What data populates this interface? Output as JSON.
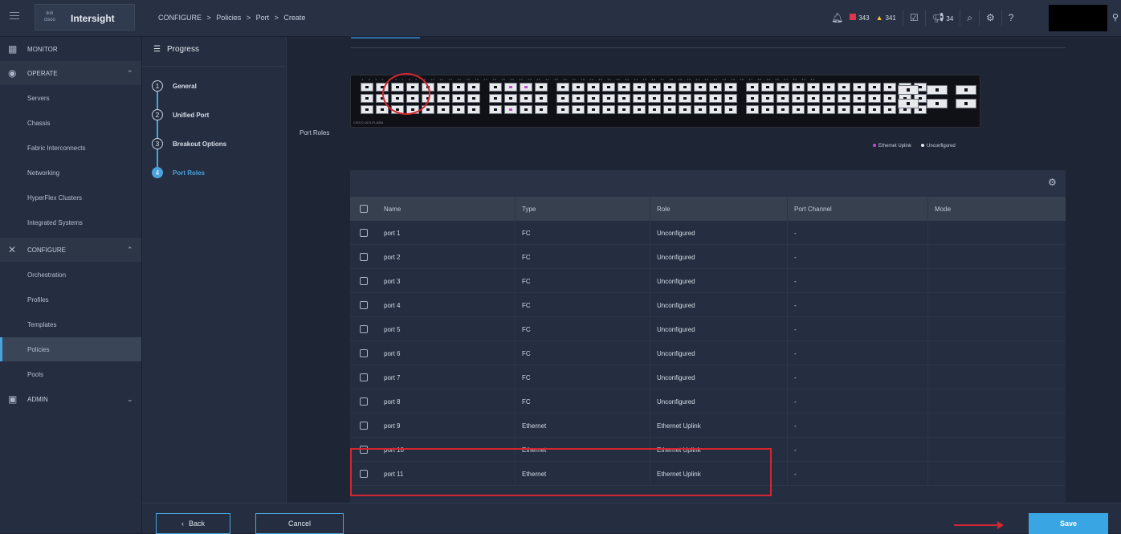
{
  "app": {
    "brand": "Intersight",
    "cisco": "cisco"
  },
  "breadcrumb": [
    "CONFIGURE",
    ">",
    "Policies",
    ">",
    "Port",
    ">",
    "Create"
  ],
  "topbar": {
    "critical_count": "343",
    "warning_count": "341",
    "announce_count": "34"
  },
  "sidebar": {
    "monitor": "MONITOR",
    "operate": "OPERATE",
    "operate_items": [
      "Servers",
      "Chassis",
      "Fabric Interconnects",
      "Networking",
      "HyperFlex Clusters",
      "Integrated Systems"
    ],
    "configure": "CONFIGURE",
    "configure_items": [
      "Orchestration",
      "Profiles",
      "Templates",
      "Policies",
      "Pools"
    ],
    "admin": "ADMIN",
    "active": "Policies"
  },
  "progress": {
    "title": "Progress",
    "steps": [
      {
        "num": "1",
        "label": "General"
      },
      {
        "num": "2",
        "label": "Unified Port"
      },
      {
        "num": "3",
        "label": "Breakout Options"
      },
      {
        "num": "4",
        "label": "Port Roles"
      }
    ],
    "current_step": 4
  },
  "main": {
    "section_label": "Port Roles",
    "switch_model": "CISCO UCS-FI-6454",
    "legend": [
      {
        "label": "Ethernet Uplink",
        "color": "#c24bd0"
      },
      {
        "label": "Unconfigured",
        "color": "#e7e9ec"
      }
    ]
  },
  "table": {
    "columns": [
      "Name",
      "Type",
      "Role",
      "Port Channel",
      "Mode"
    ],
    "rows": [
      [
        "port 1",
        "FC",
        "Unconfigured",
        "-",
        ""
      ],
      [
        "port 2",
        "FC",
        "Unconfigured",
        "-",
        ""
      ],
      [
        "port 3",
        "FC",
        "Unconfigured",
        "-",
        ""
      ],
      [
        "port 4",
        "FC",
        "Unconfigured",
        "-",
        ""
      ],
      [
        "port 5",
        "FC",
        "Unconfigured",
        "-",
        ""
      ],
      [
        "port 6",
        "FC",
        "Unconfigured",
        "-",
        ""
      ],
      [
        "port 7",
        "FC",
        "Unconfigured",
        "-",
        ""
      ],
      [
        "port 8",
        "FC",
        "Unconfigured",
        "-",
        ""
      ],
      [
        "port 9",
        "Ethernet",
        "Ethernet Uplink",
        "-",
        ""
      ],
      [
        "port 10",
        "Ethernet",
        "Ethernet Uplink",
        "-",
        ""
      ],
      [
        "port 11",
        "Ethernet",
        "Ethernet Uplink",
        "-",
        ""
      ]
    ]
  },
  "footer": {
    "back": "Back",
    "cancel": "Cancel",
    "save": "Save"
  }
}
